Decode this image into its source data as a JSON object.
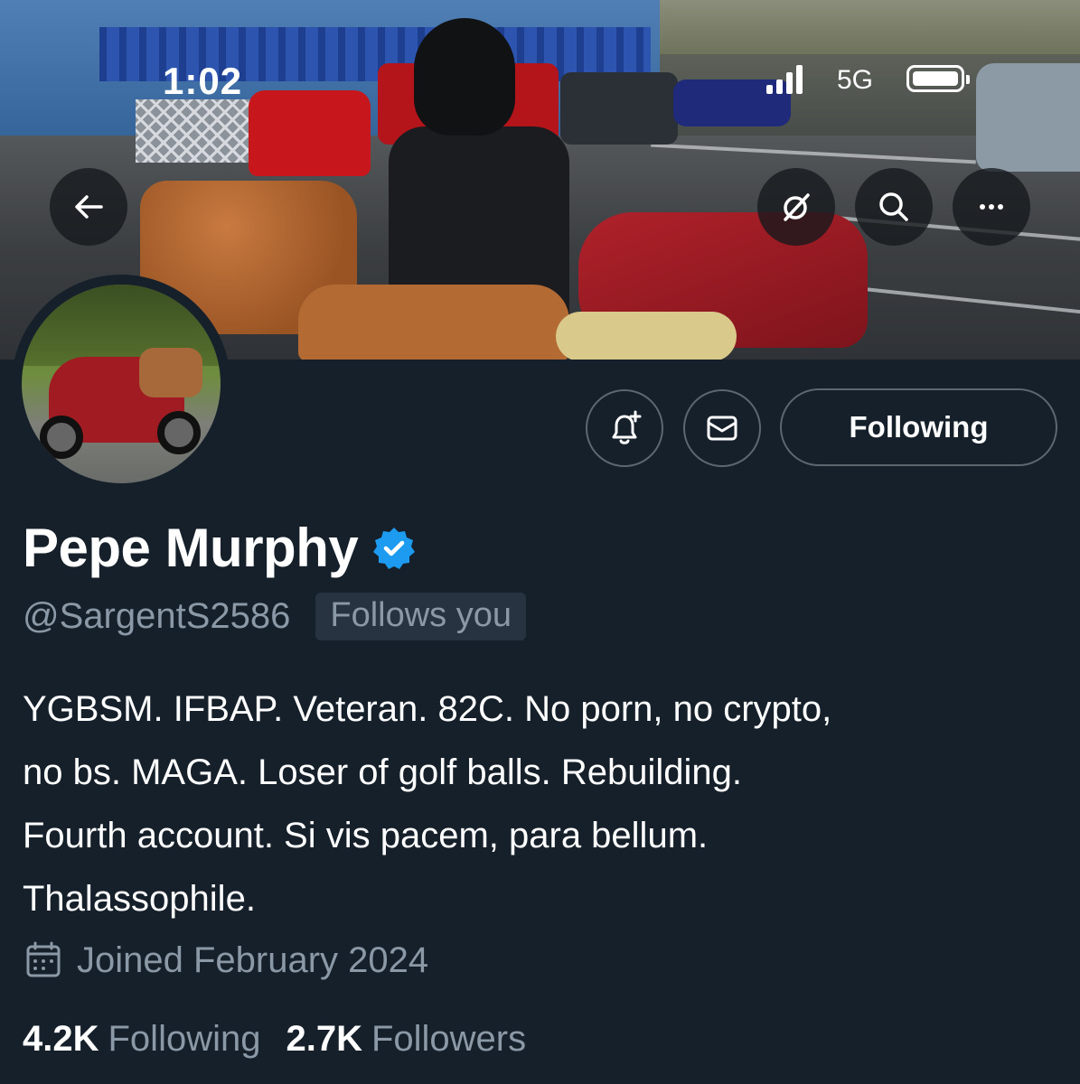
{
  "status_bar": {
    "time": "1:02",
    "network": "5G",
    "battery_level": 0.9
  },
  "header_actions": {
    "back_icon": "arrow-left-icon",
    "grok_icon": "grok-icon",
    "search_icon": "search-icon",
    "more_icon": "more-horizontal-icon"
  },
  "profile": {
    "display_name": "Pepe Murphy",
    "verified": true,
    "handle": "@SargentS2586",
    "follows_you_badge": "Follows you",
    "bio_lines": [
      "YGBSM. IFBAP. Veteran. 82C. No porn, no crypto,",
      "no bs. MAGA. Loser of golf balls. Rebuilding.",
      "Fourth account. Si vis pacem, para bellum.",
      "Thalassophile."
    ],
    "joined": "Joined February 2024",
    "following_count": "4.2K",
    "following_label": "Following",
    "followers_count": "2.7K",
    "followers_label": "Followers"
  },
  "actions": {
    "notify_icon": "bell-plus-icon",
    "message_icon": "mail-icon",
    "following_button": "Following"
  },
  "colors": {
    "background": "#15202b",
    "secondary_text": "#8b98a5",
    "verified_blue": "#1d9bf0",
    "border": "#5d6770"
  }
}
